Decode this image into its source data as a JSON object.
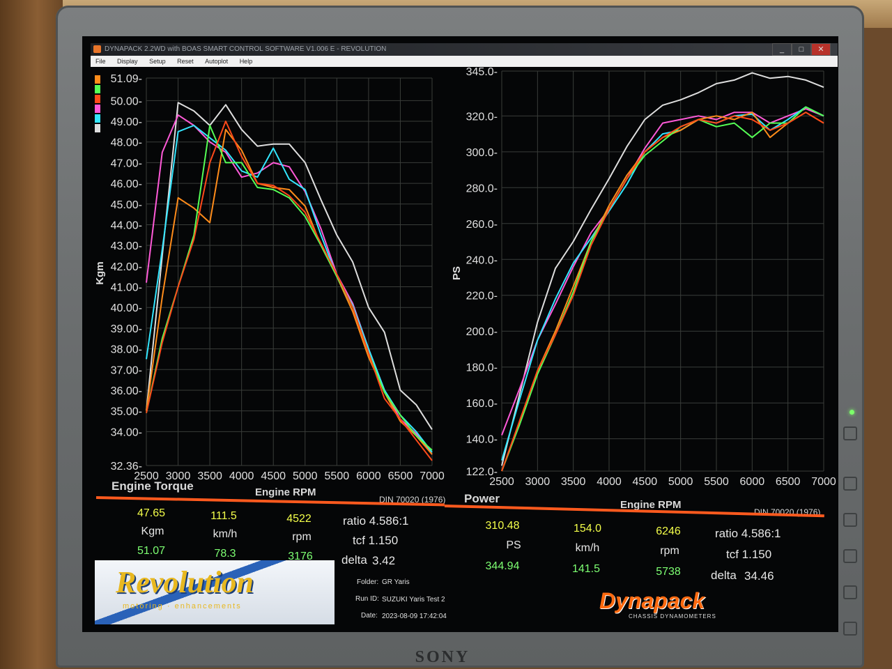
{
  "window": {
    "title": "DYNAPACK 2.2WD with BOAS SMART CONTROL SOFTWARE V1.006 E - REVOLUTION",
    "min_label": "_",
    "max_label": "□",
    "close_label": "✕"
  },
  "menu": {
    "items": [
      "File",
      "Display",
      "Setup",
      "Reset",
      "Autoplot",
      "Help"
    ]
  },
  "series_colors": {
    "orange": "#ff8c1a",
    "green": "#55ff55",
    "red": "#ff4a1a",
    "magenta": "#ff5ad8",
    "cyan": "#33e6ff",
    "white": "#dedede"
  },
  "torque_panel": {
    "label": "Engine Torque",
    "xlabel": "Engine RPM",
    "ylabel": "Kgm",
    "din": "DIN 70020 (1976)"
  },
  "power_panel": {
    "label": "Power",
    "xlabel": "Engine RPM",
    "ylabel": "PS",
    "din": "DIN 70020 (1976)"
  },
  "chart_data": [
    {
      "type": "line",
      "xlabel": "Engine RPM",
      "ylabel": "Kgm",
      "xlim": [
        2500,
        7000
      ],
      "ylim": [
        32.36,
        51.09
      ],
      "x_ticks": [
        "2500",
        "3000",
        "3500",
        "4000",
        "4500",
        "5000",
        "5500",
        "6000",
        "6500",
        "7000"
      ],
      "y_ticks": [
        "51.09-",
        "50.00-",
        "49.00-",
        "48.00-",
        "47.00-",
        "46.00-",
        "45.00-",
        "44.00-",
        "43.00-",
        "42.00-",
        "41.00-",
        "40.00-",
        "39.00-",
        "38.00-",
        "37.00-",
        "36.00-",
        "35.00-",
        "34.00-",
        "32.36-"
      ],
      "y_tick_values": [
        51.09,
        50,
        49,
        48,
        47,
        46,
        45,
        44,
        43,
        42,
        41,
        40,
        39,
        38,
        37,
        36,
        35,
        34,
        32.36
      ],
      "x": [
        2500,
        2750,
        3000,
        3250,
        3500,
        3750,
        4000,
        4250,
        4500,
        4750,
        5000,
        5250,
        5500,
        5750,
        6000,
        6250,
        6500,
        6750,
        7000
      ],
      "series": [
        {
          "color": "white",
          "values": [
            35.0,
            42.5,
            49.9,
            49.5,
            48.8,
            49.8,
            48.6,
            47.8,
            47.9,
            47.9,
            47.0,
            45.2,
            43.5,
            42.2,
            40.0,
            38.8,
            36.0,
            35.3,
            34.1
          ]
        },
        {
          "color": "magenta",
          "values": [
            41.2,
            47.5,
            49.3,
            48.8,
            48.0,
            47.5,
            46.3,
            46.5,
            47.0,
            46.8,
            45.6,
            43.8,
            41.6,
            40.2,
            38.0,
            36.0,
            34.6,
            33.9,
            32.9
          ]
        },
        {
          "color": "cyan",
          "values": [
            37.5,
            42.8,
            48.5,
            48.8,
            48.2,
            47.6,
            46.6,
            46.3,
            47.7,
            46.2,
            45.7,
            43.5,
            41.5,
            40.1,
            38.0,
            36.0,
            34.8,
            34.0,
            33.0
          ]
        },
        {
          "color": "orange",
          "values": [
            35.0,
            40.5,
            45.3,
            44.8,
            44.1,
            48.6,
            47.6,
            46.0,
            45.8,
            45.7,
            44.9,
            43.0,
            41.5,
            39.8,
            37.6,
            35.9,
            34.5,
            33.8,
            32.9
          ]
        },
        {
          "color": "green",
          "values": [
            34.9,
            38.5,
            41.0,
            43.5,
            48.8,
            47.0,
            47.0,
            45.8,
            45.7,
            45.3,
            44.4,
            43.0,
            41.5,
            40.0,
            37.8,
            35.9,
            34.8,
            33.8,
            33.1
          ]
        },
        {
          "color": "red",
          "values": [
            34.9,
            38.3,
            41.0,
            43.3,
            47.0,
            49.0,
            47.3,
            46.0,
            45.9,
            45.4,
            44.6,
            43.1,
            41.6,
            40.0,
            37.8,
            35.6,
            34.6,
            33.6,
            32.6
          ]
        }
      ]
    },
    {
      "type": "line",
      "xlabel": "Engine RPM",
      "ylabel": "PS",
      "xlim": [
        2500,
        7000
      ],
      "ylim": [
        122.0,
        345.0
      ],
      "x_ticks": [
        "2500",
        "3000",
        "3500",
        "4000",
        "4500",
        "5000",
        "5500",
        "6000",
        "6500",
        "7000"
      ],
      "y_ticks": [
        "345.0-",
        "320.0-",
        "300.0-",
        "280.0-",
        "260.0-",
        "240.0-",
        "220.0-",
        "200.0-",
        "180.0-",
        "160.0-",
        "140.0-",
        "122.0-"
      ],
      "y_tick_values": [
        345,
        320,
        300,
        280,
        260,
        240,
        220,
        200,
        180,
        160,
        140,
        122
      ],
      "x": [
        2500,
        2750,
        3000,
        3250,
        3500,
        3750,
        4000,
        4250,
        4500,
        4750,
        5000,
        5250,
        5500,
        5750,
        6000,
        6250,
        6500,
        6750,
        7000
      ],
      "series": [
        {
          "color": "white",
          "values": [
            125,
            165,
            205,
            235,
            250,
            268,
            285,
            303,
            318,
            326,
            329,
            333,
            338,
            340,
            344,
            341,
            342,
            340,
            336
          ]
        },
        {
          "color": "magenta",
          "values": [
            142,
            168,
            195,
            215,
            236,
            255,
            268,
            285,
            302,
            316,
            318,
            320,
            318,
            322,
            322,
            316,
            320,
            324,
            320
          ]
        },
        {
          "color": "cyan",
          "values": [
            128,
            162,
            195,
            218,
            238,
            252,
            267,
            282,
            300,
            310,
            312,
            318,
            316,
            320,
            321,
            312,
            318,
            325,
            320
          ]
        },
        {
          "color": "orange",
          "values": [
            122,
            150,
            178,
            200,
            225,
            250,
            270,
            287,
            300,
            308,
            312,
            318,
            320,
            318,
            322,
            308,
            316,
            322,
            316
          ]
        },
        {
          "color": "green",
          "values": [
            122,
            148,
            176,
            198,
            222,
            250,
            268,
            285,
            298,
            306,
            314,
            318,
            314,
            316,
            308,
            316,
            316,
            325,
            320
          ]
        },
        {
          "color": "red",
          "values": [
            122,
            150,
            178,
            198,
            220,
            248,
            268,
            285,
            300,
            308,
            314,
            318,
            316,
            320,
            318,
            312,
            316,
            322,
            316
          ]
        }
      ]
    }
  ],
  "torque_readout": {
    "row1": [
      "47.65",
      "111.5",
      "4522"
    ],
    "units": [
      "Kgm",
      "km/h",
      "rpm"
    ],
    "row2": [
      "51.07",
      "78.3",
      "3176"
    ],
    "ratio": "ratio  4.586:1",
    "tcf": "tcf  1.150",
    "delta_label": "delta",
    "delta_value": "3.42"
  },
  "power_readout": {
    "row1": [
      "310.48",
      "154.0",
      "6246"
    ],
    "units": [
      "PS",
      "km/h",
      "rpm"
    ],
    "row2": [
      "344.94",
      "141.5",
      "5738"
    ],
    "ratio": "ratio  4.586:1",
    "tcf": "tcf  1.150",
    "delta_label": "delta",
    "delta_value": "34.46"
  },
  "logo": {
    "name": "Revolution",
    "tagline": "motoring · enhancements"
  },
  "run_info": {
    "folder_label": "Folder:",
    "folder": "GR Yaris",
    "run_label": "Run ID:",
    "run_id": "SUZUKI Yaris Test 2",
    "date_label": "Date:",
    "date": "2023-08-09 17:42:04"
  },
  "dynapack": {
    "name": "Dynapack",
    "sub": "CHASSIS DYNAMOMETERS"
  },
  "monitor_brand": "SONY"
}
